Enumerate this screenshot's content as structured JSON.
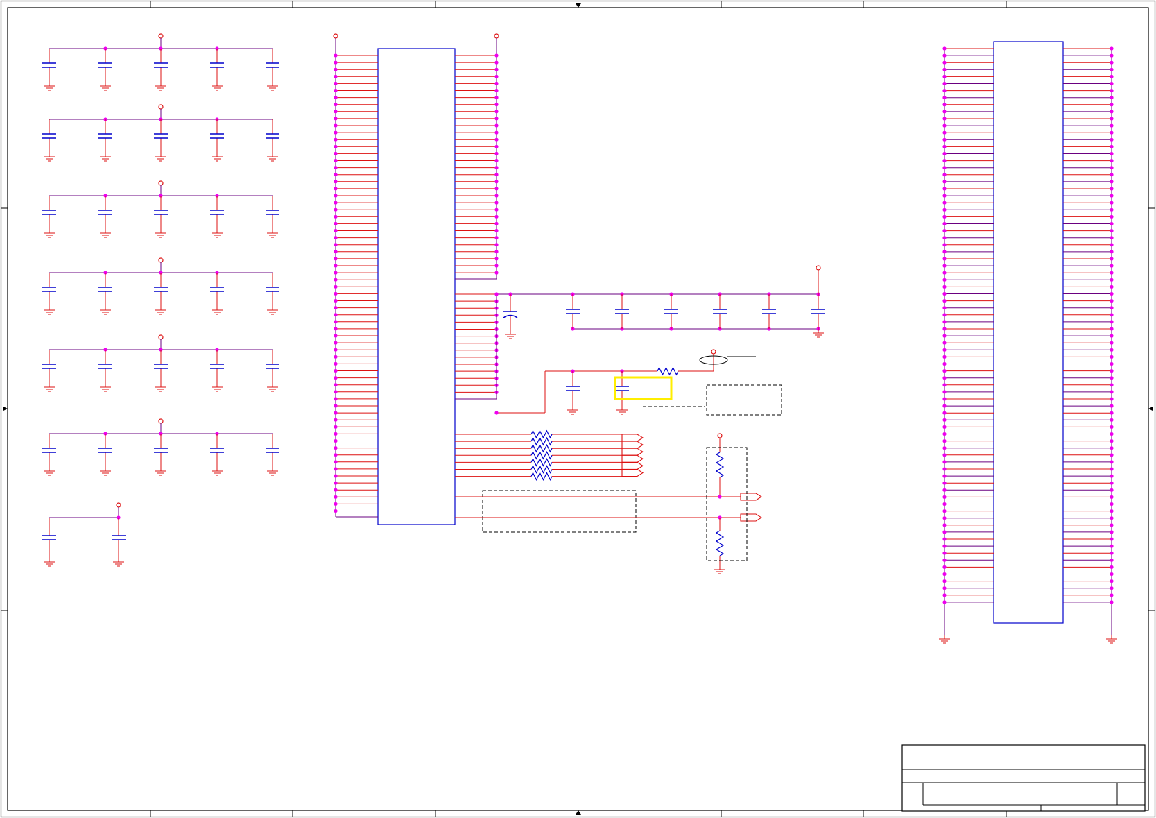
{
  "diagram": {
    "kind": "schematic-sheet",
    "text_labels": []
  },
  "colors": {
    "wire": "#dd1111",
    "net": "#6a0080",
    "junction": "#ee00ee",
    "component": "#0000cc",
    "border": "#000000",
    "highlight": "#ffee00",
    "background": "#ffffff"
  },
  "legend": {
    "power_port": "open-circle-symbol",
    "ground": "ground-symbol",
    "capacitor": "capacitor-symbol",
    "resistor": "resistor-symbol",
    "off_sheet_port": "arrow-port-symbol"
  },
  "components": {
    "decoupling_capacitor_groups": 7,
    "capacitors_per_group": [
      5,
      5,
      5,
      5,
      5,
      5,
      2
    ],
    "bulk_capacitor_row_count": 6,
    "series_resistor_count": 7,
    "output_port_count": 6,
    "level_port_count": 2,
    "divider_resistor_count": 2
  },
  "title_block": {
    "title": "",
    "doc_number": "",
    "revision": "",
    "size": "",
    "date": "",
    "sheet": ""
  }
}
